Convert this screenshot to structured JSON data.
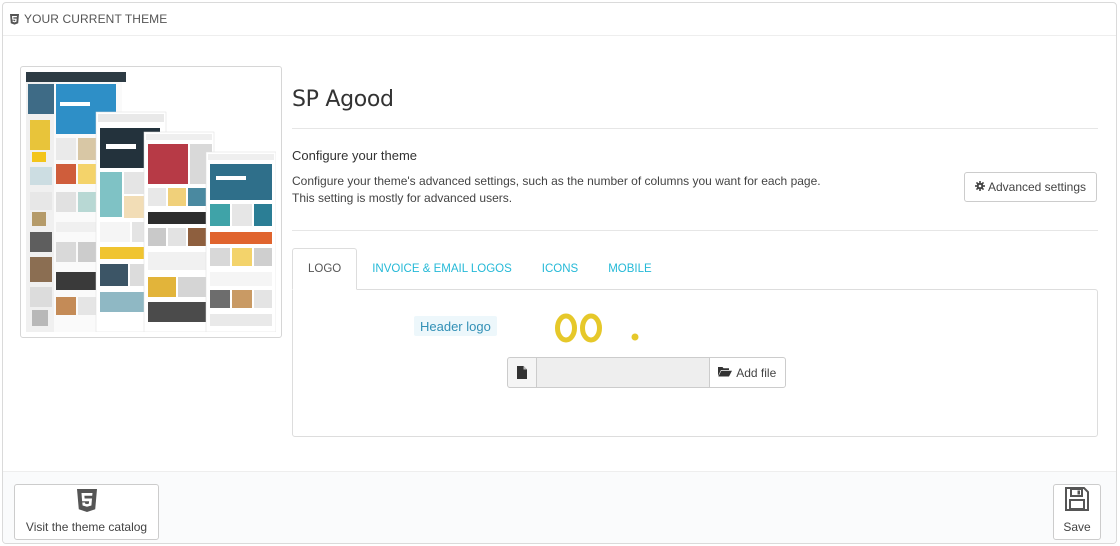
{
  "panel": {
    "title": "YOUR CURRENT THEME",
    "title_icon": "html5-icon"
  },
  "theme": {
    "name": "SP Agood",
    "preview_alt": "theme preview collage"
  },
  "configure": {
    "title": "Configure your theme",
    "description": "Configure your theme's advanced settings, such as the number of columns you want for each page. This setting is mostly for advanced users.",
    "advanced_button": "Advanced settings",
    "advanced_icon": "gear-icon"
  },
  "tabs": [
    {
      "label": "LOGO",
      "active": true
    },
    {
      "label": "INVOICE & EMAIL LOGOS",
      "active": false
    },
    {
      "label": "ICONS",
      "active": false
    },
    {
      "label": "MOBILE",
      "active": false
    }
  ],
  "logo_tab": {
    "header_logo_label": "Header logo",
    "logo_color": "#e6c82a",
    "file_input_value": "",
    "add_file_button": "Add file",
    "add_file_icon": "folder-open-icon",
    "file_icon": "file-icon"
  },
  "footer": {
    "catalog_button": "Visit the theme catalog",
    "catalog_icon": "html5-icon",
    "save_button": "Save",
    "save_icon": "floppy-disk-icon"
  },
  "colors": {
    "link": "#25b9d7",
    "label_bg": "#edf7fb",
    "label_text": "#3290b6"
  }
}
